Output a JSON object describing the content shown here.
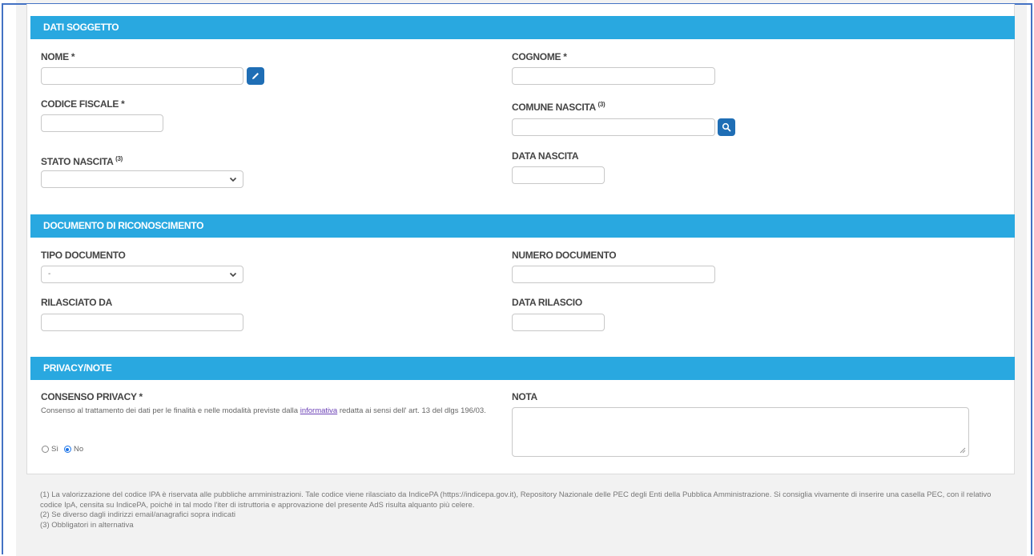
{
  "sections": {
    "soggetto": "DATI SOGGETTO",
    "documento": "DOCUMENTO DI RICONOSCIMENTO",
    "privacy": "PRIVACY/NOTE"
  },
  "fields": {
    "nome": {
      "label": "NOME *",
      "value": ""
    },
    "cognome": {
      "label": "COGNOME *",
      "value": ""
    },
    "codice_fiscale": {
      "label": "CODICE FISCALE *",
      "value": ""
    },
    "comune_nascita": {
      "label": "COMUNE NASCITA",
      "sup": "(3)",
      "value": ""
    },
    "stato_nascita": {
      "label": "STATO NASCITA",
      "sup": "(3)",
      "selected": ""
    },
    "data_nascita": {
      "label": "DATA NASCITA",
      "value": ""
    },
    "tipo_documento": {
      "label": "TIPO DOCUMENTO",
      "selected": "-"
    },
    "numero_documento": {
      "label": "NUMERO DOCUMENTO",
      "value": ""
    },
    "rilasciato_da": {
      "label": "RILASCIATO DA",
      "value": ""
    },
    "data_rilascio": {
      "label": "DATA RILASCIO",
      "value": ""
    },
    "consenso": {
      "label": "CONSENSO PRIVACY *",
      "text_before": "Consenso al trattamento dei dati per le finalità e nelle modalità previste dalla ",
      "link": "informativa",
      "text_after": " redatta ai sensi dell' art. 13 del dlgs 196/03.",
      "option_si": "Sì",
      "option_no": "No",
      "selected": "No"
    },
    "nota": {
      "label": "NOTA",
      "value": ""
    }
  },
  "footnotes": {
    "n1": "(1) La valorizzazione del codice IPA è riservata alle pubbliche amministrazioni. Tale codice viene rilasciato da IndicePA (https://indicepa.gov.it), Repository Nazionale delle PEC degli Enti della Pubblica Amministrazione. Si consiglia vivamente di inserire una casella PEC, con il relativo codice IpA, censita su IndicePA, poiché in tal modo l'iter di istruttoria e approvazione del presente AdS risulta alquanto più celere.",
    "n2": "(2) Se diverso dagli indirizzi email/anagrafici sopra indicati",
    "n3": "(3) Obbligatori in alternativa"
  },
  "colors": {
    "section_bar": "#29a8e0",
    "icon_button": "#1f6eb5",
    "frame": "#4472c4"
  },
  "icons": {
    "edit": "pencil-icon",
    "search": "search-icon",
    "select": "chevron-down-icon"
  }
}
